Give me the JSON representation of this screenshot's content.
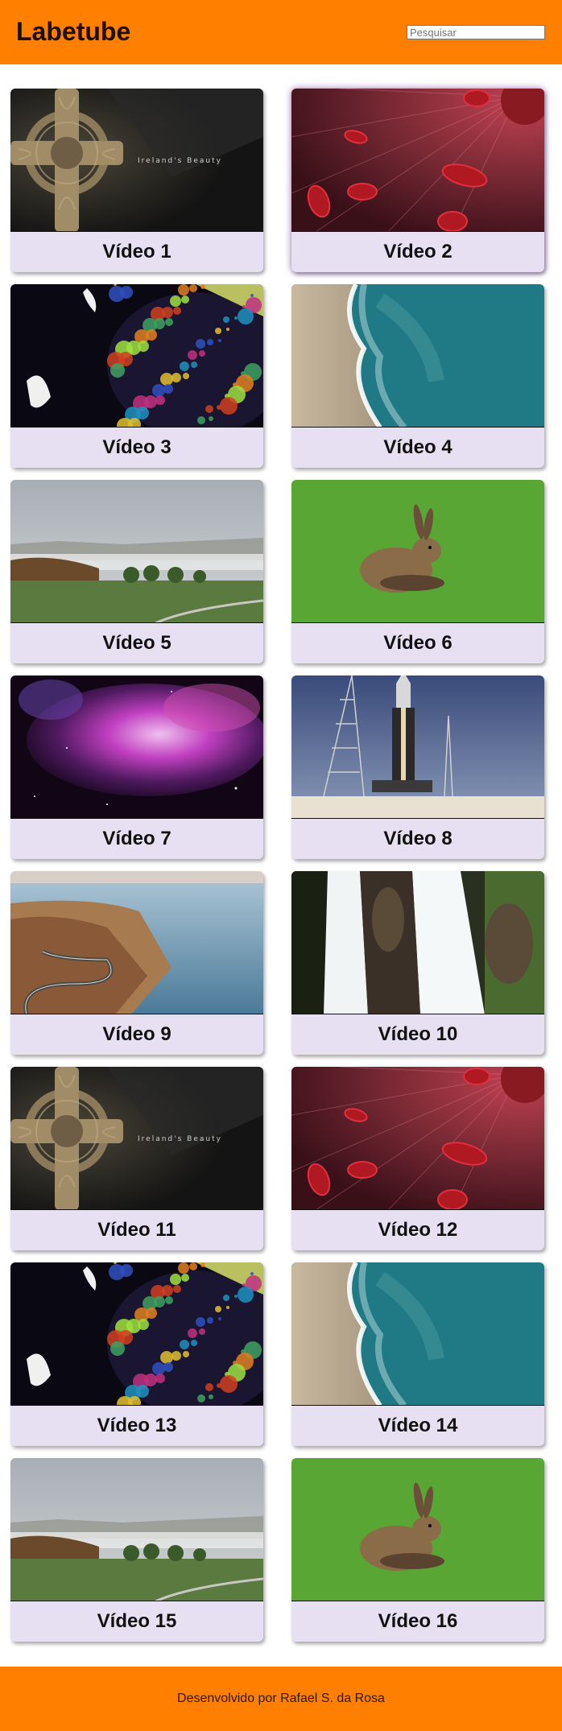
{
  "header": {
    "title": "Labetube",
    "search_placeholder": "Pesquisar",
    "background_color": "#ff7f00"
  },
  "videos": [
    {
      "title": "Vídeo 1",
      "thumbnail": "celtic-cross",
      "overlay_text": "Ireland's Beauty"
    },
    {
      "title": "Vídeo 2",
      "thumbnail": "blood-cells"
    },
    {
      "title": "Vídeo 3",
      "thumbnail": "colorful-bubbles"
    },
    {
      "title": "Vídeo 4",
      "thumbnail": "beach-aerial"
    },
    {
      "title": "Vídeo 5",
      "thumbnail": "foggy-landscape"
    },
    {
      "title": "Vídeo 6",
      "thumbnail": "hare-on-grass"
    },
    {
      "title": "Vídeo 7",
      "thumbnail": "purple-nebula"
    },
    {
      "title": "Vídeo 8",
      "thumbnail": "rocket-launchpad"
    },
    {
      "title": "Vídeo 9",
      "thumbnail": "cliff-road"
    },
    {
      "title": "Vídeo 10",
      "thumbnail": "waterfalls"
    },
    {
      "title": "Vídeo 11",
      "thumbnail": "celtic-cross",
      "overlay_text": "Ireland's Beauty"
    },
    {
      "title": "Vídeo 12",
      "thumbnail": "blood-cells"
    },
    {
      "title": "Vídeo 13",
      "thumbnail": "colorful-bubbles"
    },
    {
      "title": "Vídeo 14",
      "thumbnail": "beach-aerial"
    },
    {
      "title": "Vídeo 15",
      "thumbnail": "foggy-landscape"
    },
    {
      "title": "Vídeo 16",
      "thumbnail": "hare-on-grass"
    }
  ],
  "footer": {
    "text": "Desenvolvido por Rafael S. da Rosa",
    "background_color": "#ff7f00"
  },
  "card_color": "#e6e0f2"
}
